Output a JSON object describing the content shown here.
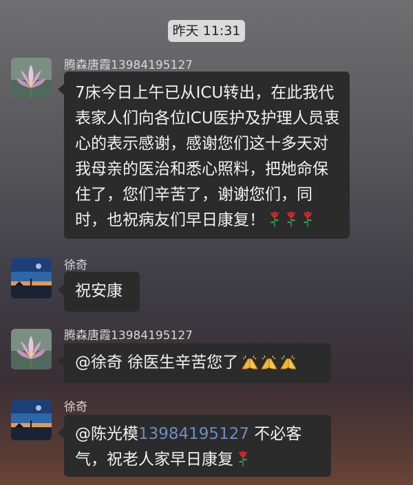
{
  "chat": {
    "timestamp": "昨天 11:31",
    "messages": [
      {
        "sender": "腾森唐霞13984195127",
        "text": "7床今日上午已从ICU转出，在此我代表家人们向各位ICU医护及护理人员衷心的表示感谢，感谢您们这十多天对我母亲的医治和悉心照料，把她命保住了，您们辛苦了，谢谢您们，同时，也祝病友们早日康复！",
        "emojis": [
          "rose-icon",
          "rose-icon",
          "rose-icon"
        ]
      },
      {
        "sender": "徐奇",
        "text": "祝安康"
      },
      {
        "sender": "腾森唐霞13984195127",
        "text": "@徐奇 徐医生辛苦您了",
        "emojis": [
          "folded-hands-icon",
          "folded-hands-icon",
          "folded-hands-icon"
        ]
      },
      {
        "sender": "徐奇",
        "text_prefix": "@陈光模",
        "text_link": "13984195127",
        "text_suffix": " 不必客气，祝老人家早日康复",
        "emojis": [
          "rose-icon"
        ]
      }
    ]
  },
  "colors": {
    "bubble": "#2b2b2b",
    "timestamp_bg": "#dadada",
    "link": "#6c8fbf"
  }
}
